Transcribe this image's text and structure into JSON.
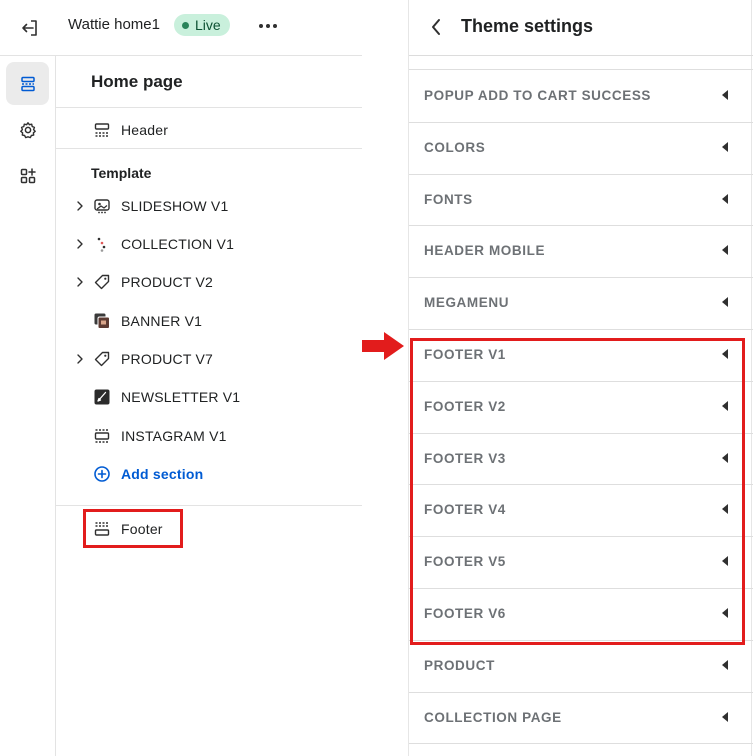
{
  "topbar": {
    "store_name": "Wattie home1",
    "status_badge": "Live",
    "exit_icon": "exit-icon",
    "more_icon": "more-horizontal-icon"
  },
  "rail": {
    "items": [
      {
        "icon": "sections-icon",
        "active": true
      },
      {
        "icon": "gear-icon",
        "active": false
      },
      {
        "icon": "apps-icon",
        "active": false
      }
    ]
  },
  "sidebar": {
    "page_title": "Home page",
    "header_label": "Header",
    "template_label": "Template",
    "sections": [
      {
        "label": "SLIDESHOW V1",
        "expandable": true,
        "icon": "slideshow-icon"
      },
      {
        "label": "COLLECTION V1",
        "expandable": true,
        "icon": "collection-icon"
      },
      {
        "label": "PRODUCT V2",
        "expandable": true,
        "icon": "tag-icon"
      },
      {
        "label": "BANNER V1",
        "expandable": false,
        "icon": "banner-icon"
      },
      {
        "label": "PRODUCT V7",
        "expandable": true,
        "icon": "tag-icon"
      },
      {
        "label": "NEWSLETTER V1",
        "expandable": false,
        "icon": "newsletter-icon"
      },
      {
        "label": "INSTAGRAM V1",
        "expandable": false,
        "icon": "instagram-section-icon"
      }
    ],
    "add_section_label": "Add section",
    "footer_label": "Footer"
  },
  "theme_settings": {
    "title": "Theme settings",
    "items": [
      "POPUP ADD TO CART SUCCESS",
      "COLORS",
      "FONTS",
      "HEADER MOBILE",
      "MEGAMENU",
      "FOOTER V1",
      "FOOTER V2",
      "FOOTER V3",
      "FOOTER V4",
      "FOOTER V5",
      "FOOTER V6",
      "PRODUCT",
      "COLLECTION PAGE"
    ]
  },
  "colors": {
    "accent": "#005bd3",
    "highlight": "#e21c1c",
    "live_bg": "#c9f0dc",
    "live_dot": "#29845a"
  }
}
